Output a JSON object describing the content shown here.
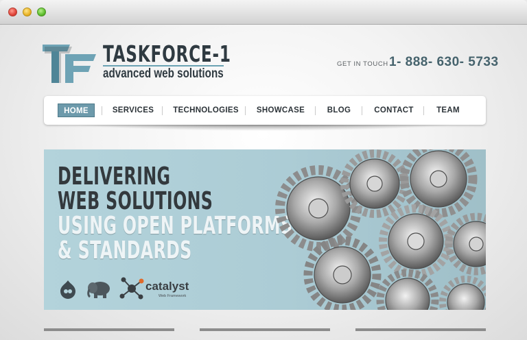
{
  "brand": {
    "name": "TASKFORCE-1",
    "tagline": "advanced web solutions"
  },
  "contact": {
    "label": "GET IN TOUCH",
    "phone": "1- 888- 630- 5733"
  },
  "nav": {
    "items": [
      {
        "label": "HOME",
        "active": true
      },
      {
        "label": "SERVICES",
        "active": false
      },
      {
        "label": "TECHNOLOGIES",
        "active": false
      },
      {
        "label": "SHOWCASE",
        "active": false
      },
      {
        "label": "BLOG",
        "active": false
      },
      {
        "label": "CONTACT",
        "active": false
      },
      {
        "label": "TEAM",
        "active": false
      }
    ]
  },
  "hero": {
    "lines": [
      "DELIVERING",
      "WEB SOLUTIONS",
      "USING OPEN PLATFORMS",
      "& STANDARDS"
    ],
    "logos": [
      "drupal-icon",
      "php-elephant-icon",
      "catalyst-icon"
    ],
    "catalyst_name": "catalyst",
    "catalyst_sub": "Web Framework"
  },
  "colors": {
    "accent": "#6d9aab",
    "hero_bg": "#b3d3db",
    "text_dark": "#33393d"
  }
}
